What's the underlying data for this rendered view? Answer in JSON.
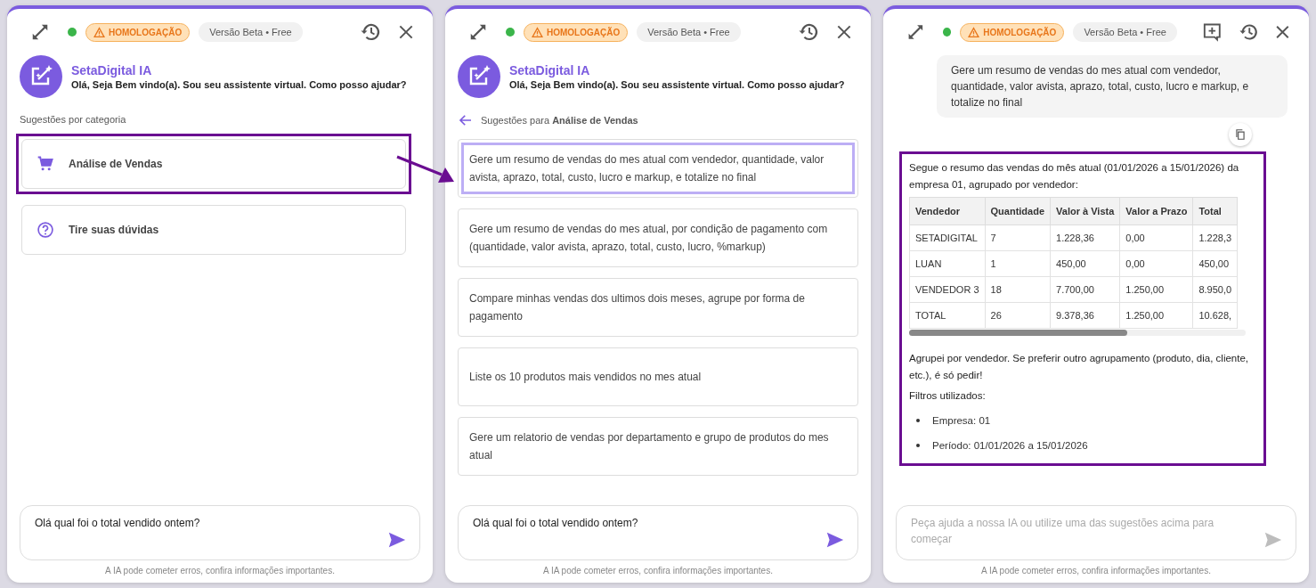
{
  "panels": [
    {
      "header": {
        "online": true,
        "badge": "HOMOLOGAÇÃO",
        "version": "Versão Beta • Free",
        "new_chat": false
      },
      "assistant": {
        "name": "SetaDigital IA",
        "greeting": "Olá, Seja Bem vindo(a). Sou seu assistente virtual. Como posso ajudar?"
      },
      "kind": "categories",
      "section_label": "Sugestões por categoria",
      "categories": [
        {
          "kind": "cart",
          "label": "Análise de Vendas",
          "highlighted": true
        },
        {
          "kind": "help",
          "label": "Tire suas dúvidas",
          "highlighted": false
        }
      ],
      "input": {
        "value": "Olá qual foi o total vendido ontem?"
      },
      "disclaimer": "A IA pode cometer erros, confira informações importantes."
    },
    {
      "header": {
        "online": true,
        "badge": "HOMOLOGAÇÃO",
        "version": "Versão Beta • Free",
        "new_chat": false
      },
      "assistant": {
        "name": "SetaDigital IA",
        "greeting": "Olá, Seja Bem vindo(a). Sou seu assistente virtual. Como posso ajudar?"
      },
      "kind": "suggestions",
      "section_label": "Sugestões para **Análise de Vendas**",
      "suggestions": [
        {
          "text": "Gere um resumo de vendas do mes atual com vendedor, quantidade, valor avista, aprazo, total, custo, lucro e markup, e totalize no final",
          "focused": true
        },
        {
          "text": "Gere um resumo de vendas do mes atual, por condição de pagamento com (quantidade, valor avista, aprazo, total, custo, lucro, %markup)",
          "focused": false
        },
        {
          "text": "Compare minhas vendas dos ultimos dois meses, agrupe por forma de pagamento",
          "focused": false
        },
        {
          "text": "Liste os 10 produtos mais vendidos no mes atual",
          "focused": false
        },
        {
          "text": "Gere um relatorio de vendas por departamento e grupo de produtos do mes atual",
          "focused": false
        }
      ],
      "input": {
        "value": "Olá qual foi o total vendido ontem?"
      },
      "disclaimer": "A IA pode cometer erros, confira informações importantes."
    },
    {
      "header": {
        "online": true,
        "badge": "HOMOLOGAÇÃO",
        "version": "Versão Beta • Free",
        "new_chat": true
      },
      "kind": "chat",
      "messages": [
        {
          "kind": "user",
          "text": "Gere um resumo de vendas do mes atual com vendedor, quantidade, valor avista, aprazo, total, custo, lucro e markup, e totalize no final"
        },
        {
          "kind": "assistant",
          "highlighted": true,
          "intro": "Segue o resumo das vendas do mês atual (01/01/2026 a 15/01/2026) da empresa 01, agrupado por vendedor:",
          "table": {
            "columns": [
              "Vendedor",
              "Quantidade",
              "Valor à Vista",
              "Valor a Prazo",
              "Total"
            ],
            "rows": [
              [
                "SETADIGITAL",
                "7",
                "1.228,36",
                "0,00",
                "1.228,3"
              ],
              [
                "LUAN",
                "1",
                "450,00",
                "0,00",
                "450,00"
              ],
              [
                "VENDEDOR 3",
                "18",
                "7.700,00",
                "1.250,00",
                "8.950,0"
              ],
              [
                "TOTAL",
                "26",
                "9.378,36",
                "1.250,00",
                "10.628,"
              ]
            ]
          },
          "outro": "Agrupei por vendedor. Se preferir outro agrupamento (produto, dia, cliente, etc.), é só pedir!",
          "filters_label": "Filtros utilizados:",
          "filters": [
            "Empresa: 01",
            "Período: 01/01/2026 a 15/01/2026"
          ]
        }
      ],
      "input": {
        "placeholder": "Peça ajuda a nossa IA ou utilize uma das sugestões acima para começar"
      },
      "disclaimer": "A IA pode cometer erros, confira informações importantes."
    }
  ]
}
